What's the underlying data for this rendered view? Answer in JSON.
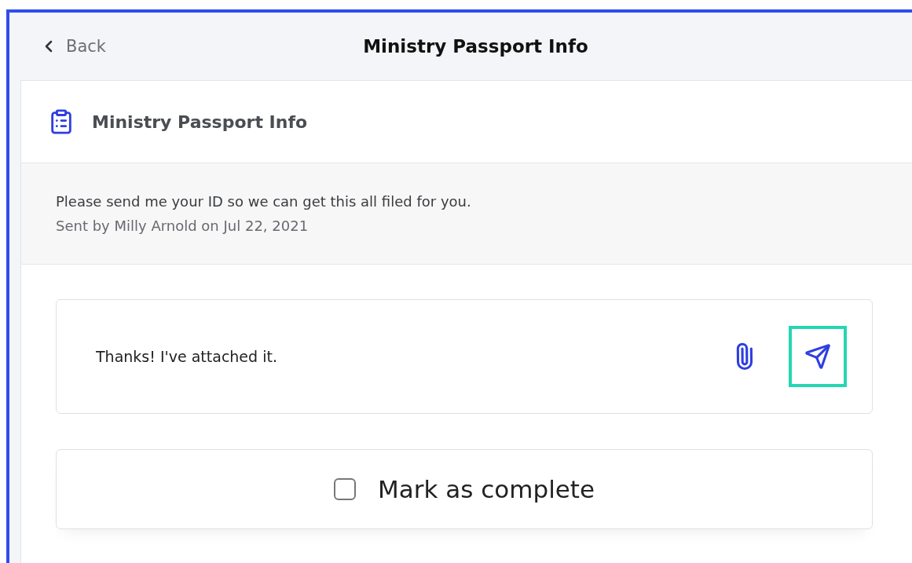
{
  "header": {
    "back_label": "Back",
    "title": "Ministry Passport Info"
  },
  "card": {
    "title": "Ministry Passport Info",
    "message": {
      "text": "Please send me your ID so we can get this all filed for you.",
      "meta": "Sent by Milly Arnold on Jul 22, 2021"
    },
    "reply": {
      "value": "Thanks! I've attached it."
    },
    "complete": {
      "label": "Mark as complete",
      "checked": false
    }
  }
}
